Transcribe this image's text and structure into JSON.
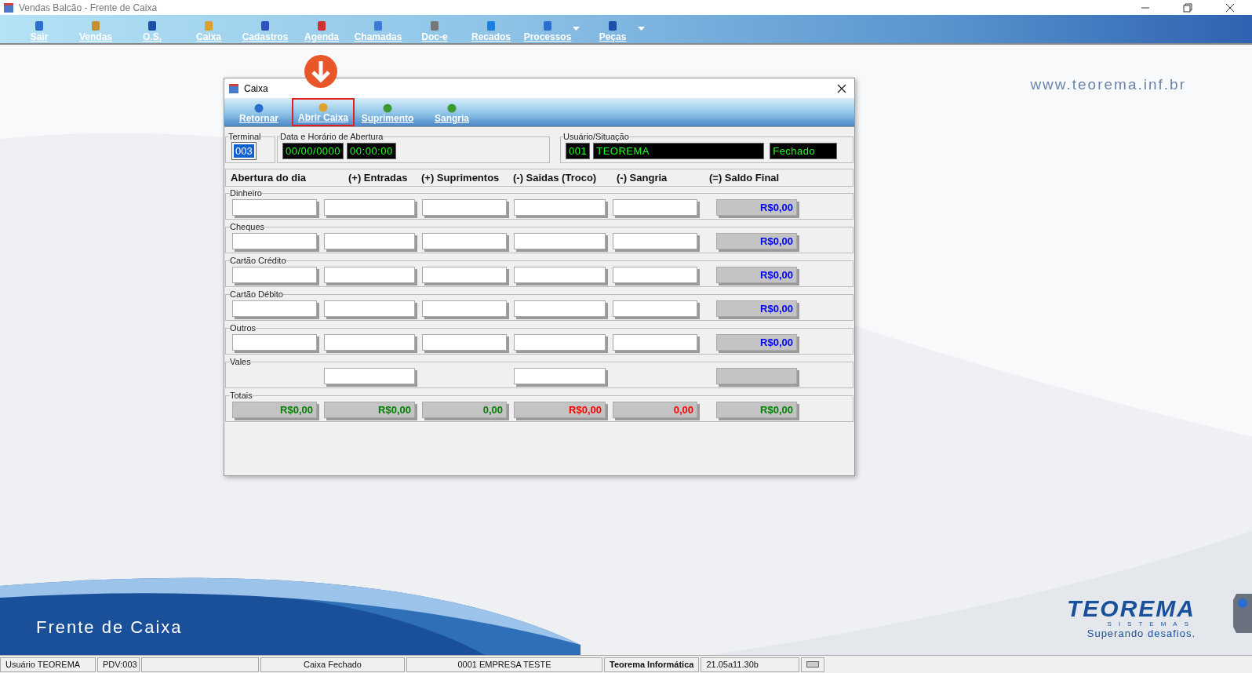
{
  "window": {
    "title": "Vendas Balcão - Frente de Caixa"
  },
  "toolbar": [
    {
      "label": "Sair",
      "has_menu": false
    },
    {
      "label": "Vendas",
      "has_menu": false
    },
    {
      "label": "O.S.",
      "has_menu": false
    },
    {
      "label": "Caixa",
      "has_menu": false
    },
    {
      "label": "Cadastros",
      "has_menu": false
    },
    {
      "label": "Agenda",
      "has_menu": false
    },
    {
      "label": "Chamadas",
      "has_menu": false
    },
    {
      "label": "Doc-e",
      "has_menu": false
    },
    {
      "label": "Recados",
      "has_menu": false
    },
    {
      "label": "Processos",
      "has_menu": true
    },
    {
      "label": "Peças",
      "has_menu": true
    }
  ],
  "background": {
    "url": "www.teorema.inf.br",
    "banner": "Frente de Caixa",
    "logo": "TEOREMA",
    "logo_sub": "SISTEMAS",
    "slogan": "Superando desafios."
  },
  "dialog": {
    "title": "Caixa",
    "actions": [
      {
        "label": "Retornar",
        "highlighted": false
      },
      {
        "label": "Abrir Caixa",
        "highlighted": true
      },
      {
        "label": "Suprimento",
        "highlighted": false
      },
      {
        "label": "Sangria",
        "highlighted": false
      }
    ],
    "terminal": {
      "label": "Terminal",
      "value": "003"
    },
    "opening": {
      "label": "Data e Horário de Abertura",
      "date": "00/00/0000",
      "time": "00:00:00"
    },
    "user": {
      "label": "Usuário/Situação",
      "code": "001",
      "name": "TEOREMA",
      "status": "Fechado"
    },
    "columns": [
      "Abertura do dia",
      "(+) Entradas",
      "(+) Suprimentos",
      "(-) Saidas (Troco)",
      "(-) Sangria",
      "(=) Saldo Final"
    ],
    "rows": [
      {
        "label": "Dinheiro",
        "cells": [
          {
            "kind": "input"
          },
          {
            "kind": "input"
          },
          {
            "kind": "input"
          },
          {
            "kind": "input"
          },
          {
            "kind": "input"
          },
          {
            "kind": "total",
            "value": "R$0,00",
            "color": "#0000ff"
          }
        ]
      },
      {
        "label": "Cheques",
        "cells": [
          {
            "kind": "input"
          },
          {
            "kind": "input"
          },
          {
            "kind": "input"
          },
          {
            "kind": "input"
          },
          {
            "kind": "input"
          },
          {
            "kind": "total",
            "value": "R$0,00",
            "color": "#0000ff"
          }
        ]
      },
      {
        "label": "Cartão Crédito",
        "cells": [
          {
            "kind": "input"
          },
          {
            "kind": "input"
          },
          {
            "kind": "input"
          },
          {
            "kind": "input"
          },
          {
            "kind": "input"
          },
          {
            "kind": "total",
            "value": "R$0,00",
            "color": "#0000ff"
          }
        ]
      },
      {
        "label": "Cartão Débito",
        "cells": [
          {
            "kind": "input"
          },
          {
            "kind": "input"
          },
          {
            "kind": "input"
          },
          {
            "kind": "input"
          },
          {
            "kind": "input"
          },
          {
            "kind": "total",
            "value": "R$0,00",
            "color": "#0000ff"
          }
        ]
      },
      {
        "label": "Outros",
        "cells": [
          {
            "kind": "input"
          },
          {
            "kind": "input"
          },
          {
            "kind": "input"
          },
          {
            "kind": "input"
          },
          {
            "kind": "input"
          },
          {
            "kind": "total",
            "value": "R$0,00",
            "color": "#0000ff"
          }
        ]
      },
      {
        "label": "Vales",
        "cells": [
          {
            "kind": "empty"
          },
          {
            "kind": "input"
          },
          {
            "kind": "empty"
          },
          {
            "kind": "input"
          },
          {
            "kind": "empty"
          },
          {
            "kind": "total"
          }
        ]
      },
      {
        "label": "Totais",
        "cells": [
          {
            "kind": "total",
            "value": "R$0,00",
            "color": "#008000"
          },
          {
            "kind": "total",
            "value": "R$0,00",
            "color": "#008000"
          },
          {
            "kind": "total",
            "value": "0,00",
            "color": "#008000"
          },
          {
            "kind": "total",
            "value": "R$0,00",
            "color": "#ff0000"
          },
          {
            "kind": "total",
            "value": "0,00",
            "color": "#ff0000"
          },
          {
            "kind": "total",
            "value": "R$0,00",
            "color": "#008000"
          }
        ]
      }
    ]
  },
  "status_bar": [
    {
      "text": "Usuário TEOREMA",
      "bold": false
    },
    {
      "text": "PDV:003",
      "bold": false
    },
    {
      "text": "Caixa Fechado",
      "bold": false
    },
    {
      "text": "0001 EMPRESA TESTE",
      "bold": false
    },
    {
      "text": "Teorema Informática",
      "bold": true
    },
    {
      "text": "21.05a11.30b",
      "bold": false
    }
  ]
}
